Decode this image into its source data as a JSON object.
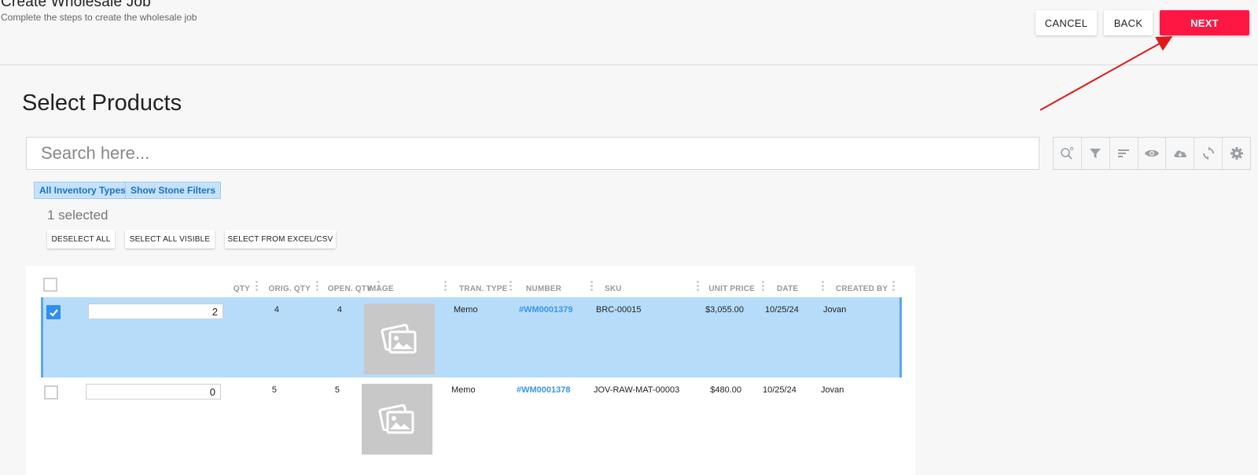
{
  "header": {
    "title": "Create Wholesale Job",
    "subtitle": "Complete the steps to create the wholesale job",
    "cancel_label": "CANCEL",
    "back_label": "BACK",
    "next_label": "NEXT"
  },
  "section": {
    "title": "Select Products"
  },
  "search": {
    "placeholder": "Search here..."
  },
  "toolbar": {
    "icons": [
      "search-options-icon",
      "filter-icon",
      "sort-icon",
      "eye-icon",
      "cloud-download-icon",
      "refresh-icon",
      "gear-icon"
    ]
  },
  "chips": {
    "inventory_types": "All Inventory Types",
    "stone_filters": "Show Stone Filters"
  },
  "selection": {
    "count_text": "1 selected",
    "deselect_all": "DESELECT ALL",
    "select_all_visible": "SELECT ALL VISIBLE",
    "select_from_excel": "SELECT FROM EXCEL/CSV"
  },
  "table": {
    "columns": {
      "qty": "QTY",
      "orig_qty": "ORIG. QTY",
      "open_qty": "OPEN. QTY",
      "image": "IMAGE",
      "tran_type": "TRAN. TYPE",
      "number": "NUMBER",
      "sku": "SKU",
      "unit_price": "UNIT PRICE",
      "date": "DATE",
      "created_by": "CREATED BY"
    },
    "rows": [
      {
        "selected": true,
        "qty": "2",
        "orig_qty": "4",
        "open_qty": "4",
        "tran_type": "Memo",
        "number": "#WM0001379",
        "sku": "BRC-00015",
        "unit_price": "$3,055.00",
        "date": "10/25/24",
        "created_by": "Jovan"
      },
      {
        "selected": false,
        "qty": "0",
        "orig_qty": "5",
        "open_qty": "5",
        "tran_type": "Memo",
        "number": "#WM0001378",
        "sku": "JOV-RAW-MAT-00003",
        "unit_price": "$480.00",
        "date": "10/25/24",
        "created_by": "Jovan"
      }
    ]
  },
  "colors": {
    "accent": "#ff1744",
    "selected_row": "#b7dcfa",
    "link": "#3a96e8",
    "annotation_arrow": "#e01919"
  }
}
